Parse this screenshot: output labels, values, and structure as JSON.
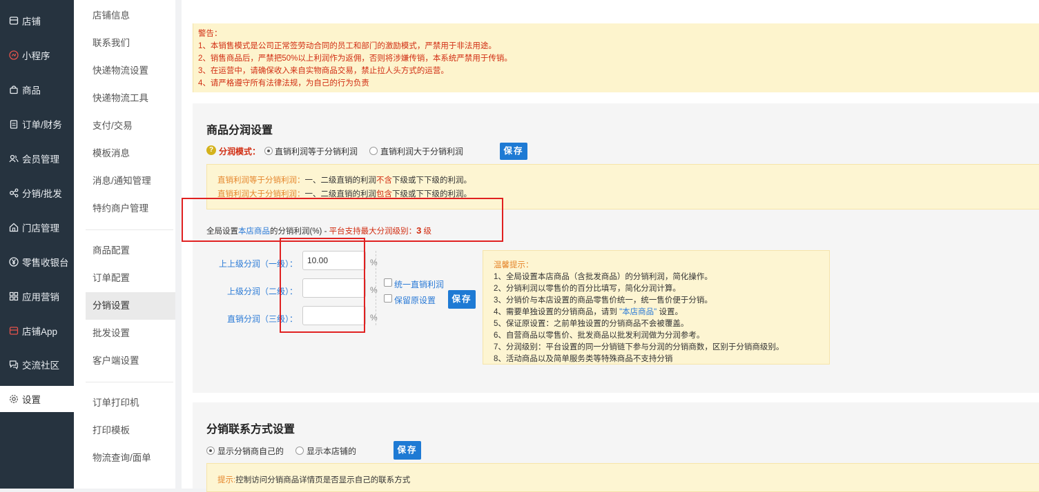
{
  "sidebar": {
    "items": [
      {
        "label": "店铺",
        "icon": "store-icon"
      },
      {
        "label": "小程序",
        "icon": "miniprogram-icon"
      },
      {
        "label": "商品",
        "icon": "bag-icon"
      },
      {
        "label": "订单/财务",
        "icon": "clipboard-icon"
      },
      {
        "label": "会员管理",
        "icon": "users-icon"
      },
      {
        "label": "分销/批发",
        "icon": "share-icon"
      },
      {
        "label": "门店管理",
        "icon": "house-icon"
      },
      {
        "label": "零售收银台",
        "icon": "yen-icon"
      },
      {
        "label": "应用营销",
        "icon": "apps-icon"
      },
      {
        "label": "店铺App",
        "icon": "app-icon"
      },
      {
        "label": "交流社区",
        "icon": "chat-icon"
      },
      {
        "label": "设置",
        "icon": "gear-icon"
      }
    ]
  },
  "submenu": {
    "items": [
      "店铺信息",
      "联系我们",
      "快递物流设置",
      "快递物流工具",
      "支付/交易",
      "模板消息",
      "消息/通知管理",
      "特约商户管理",
      "商品配置",
      "订单配置",
      "分销设置",
      "批发设置",
      "客户端设置",
      "订单打印机",
      "打印模板",
      "物流查询/面单"
    ]
  },
  "alert": {
    "title": "警告：",
    "lines": [
      "1、本销售模式是公司正常签劳动合同的员工和部门的激励模式，严禁用于非法用途。",
      "2、销售商品后，严禁把50%以上利润作为返佣，否则将涉嫌传销，本系统严禁用于传销。",
      "3、在运营中，请确保收入来自实物商品交易，禁止拉人头方式的运营。",
      "4、请严格遵守所有法律法规，为自己的行为负责"
    ]
  },
  "profit": {
    "title": "商品分润设置",
    "help_icon": "?",
    "mode_label": "分润模式：",
    "option1": "直销利润等于分销利润",
    "option2": "直销利润大于分销利润",
    "save_label": "保存",
    "info1_key": "直销利润等于分销利润：",
    "info1_pre": "一、二级直销的利润",
    "info1_hl": "不含",
    "info1_post": "下级或下下级的利润。",
    "info2_key": "直销利润大于分销利润：",
    "info2_pre": "一、二级直销的利润",
    "info2_hl": "包含",
    "info2_post": "下级或下下级的利润。",
    "global_pre": "全局设置",
    "global_link": "本店商品",
    "global_mid": "的分销利润(%) - ",
    "global_red": "平台支持最大分润级别：",
    "global_num": "3",
    "global_unit": " 级",
    "levels": [
      {
        "label": "上上级分润（一级）：",
        "value": "10.00",
        "placeholder": ""
      },
      {
        "label": "上级分润（二级）：",
        "value": "",
        "placeholder": ""
      },
      {
        "label": "直销分润（三级）：",
        "value": "",
        "placeholder": ""
      }
    ],
    "percent": "%",
    "check1": "统一直销利润",
    "check2": "保留原设置",
    "save2_label": "保存",
    "tips_title": "温馨提示：",
    "tips": [
      "1、全局设置本店商品（含批发商品）的分销利润，简化操作。",
      "2、分销利润以零售价的百分比填写，简化分润计算。",
      "3、分销价与本店设置的商品零售价统一，统一售价便于分销。",
      "5、保证原设置：之前单独设置的分销商品不会被覆盖。",
      "6、自营商品以零售价、批发商品以批发利润做为分润参考。",
      "7、分润级别：平台设置的同一分销链下参与分润的分销商数，区别于分销商级别。",
      "8、活动商品以及简单服务类等特殊商品不支持分销"
    ],
    "tip4_pre": "4、需要单独设置的分销商品，请到 ",
    "tip4_link": "\"本店商品\"",
    "tip4_post": " 设置。"
  },
  "contact": {
    "title": "分销联系方式设置",
    "option1": "显示分销商自己的",
    "option2": "显示本店铺的",
    "save_label": "保存",
    "hint_key": "提示:",
    "hint_text": "控制访问分销商品详情页是否显示自己的联系方式"
  },
  "colors": {
    "sidebar_bg": "#26333f",
    "accent": "#1e7ad4",
    "warning": "#d12d12",
    "alert_bg": "#fdf4cd",
    "annotation": "#e02020"
  }
}
